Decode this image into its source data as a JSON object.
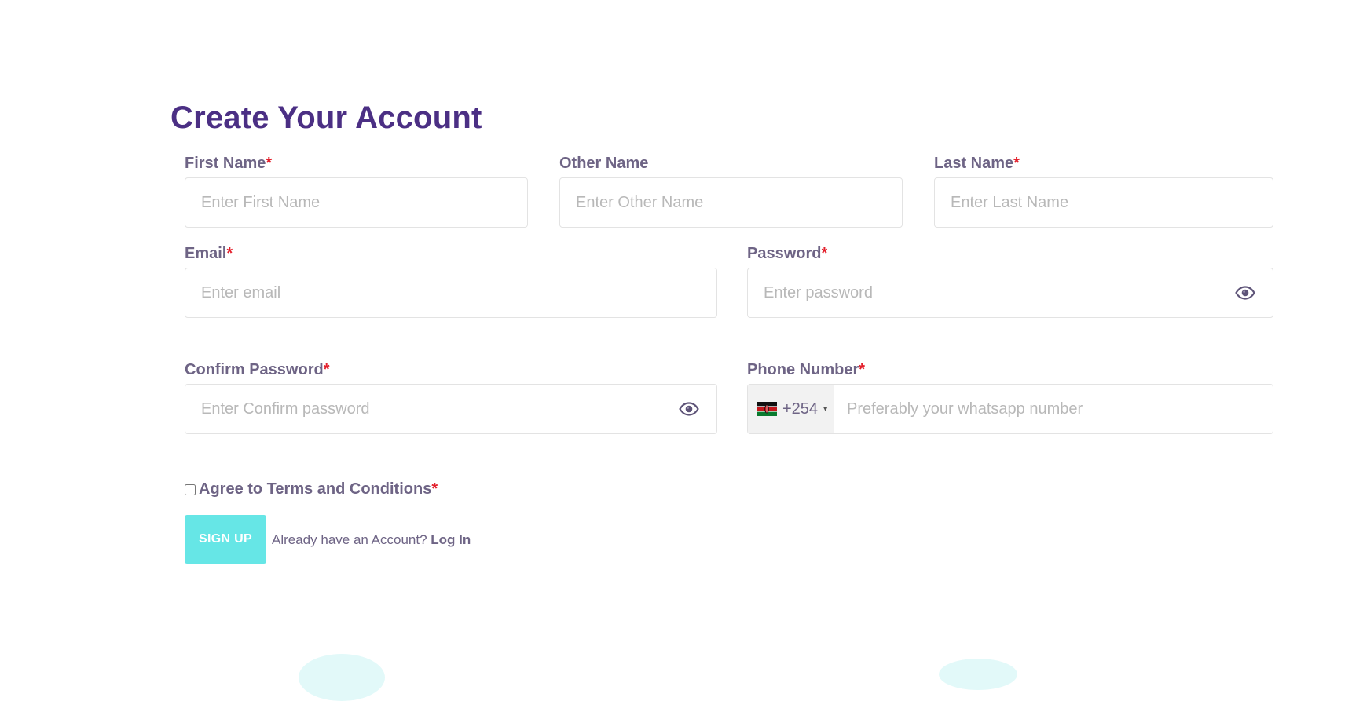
{
  "page": {
    "title": "Create Your Account"
  },
  "form": {
    "required_marker": "*",
    "first_name": {
      "label": "First Name",
      "placeholder": "Enter First Name",
      "value": "",
      "required": true
    },
    "other_name": {
      "label": "Other Name",
      "placeholder": "Enter Other Name",
      "value": "",
      "required": false
    },
    "last_name": {
      "label": "Last Name",
      "placeholder": "Enter Last Name",
      "value": "",
      "required": true
    },
    "email": {
      "label": "Email",
      "placeholder": "Enter email",
      "value": "",
      "required": true
    },
    "password": {
      "label": "Password",
      "placeholder": "Enter password",
      "value": "",
      "required": true,
      "icon": "eye-icon"
    },
    "confirm_password": {
      "label": "Confirm Password",
      "placeholder": "Enter Confirm password",
      "value": "",
      "required": true,
      "icon": "eye-icon"
    },
    "phone": {
      "label": "Phone Number",
      "placeholder": "Preferably your whatsapp number",
      "value": "",
      "required": true,
      "country": {
        "flag": "kenya-flag-icon",
        "dial_code": "+254",
        "caret": "▾"
      }
    },
    "terms": {
      "label": "Agree to Terms and Conditions",
      "checked": false,
      "required": true
    },
    "submit_label": "SIGN UP",
    "login_prompt": "Already have an Account?",
    "login_link": "Log In"
  },
  "colors": {
    "title": "#4b2f84",
    "label": "#6e6485",
    "required": "#e3202c",
    "button": "#66e6e6",
    "placeholder": "#b8b8b8",
    "input_border": "#e3e3e3"
  }
}
